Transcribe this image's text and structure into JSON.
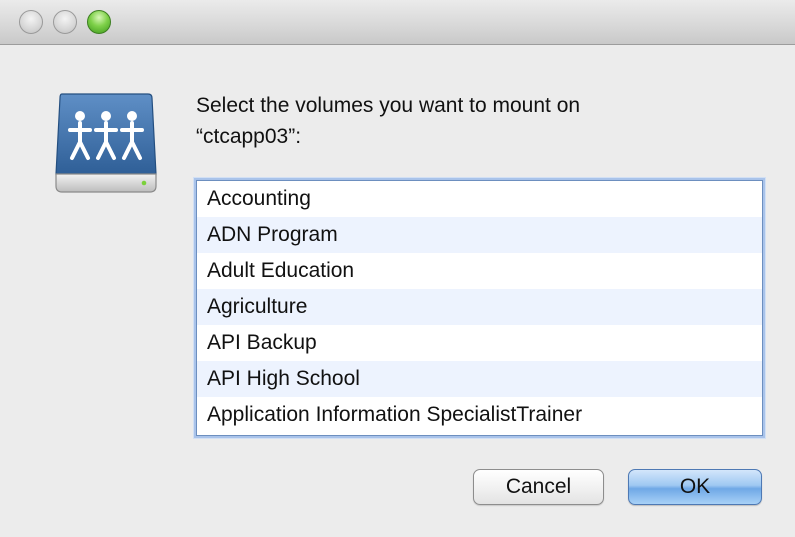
{
  "window": {
    "traffic_lights": [
      "close",
      "minimize",
      "zoom"
    ]
  },
  "dialog": {
    "icon": "shared-network-drive-icon",
    "prompt": "Select the volumes you want to mount on\n“ctcapp03”:",
    "volumes": [
      "Accounting",
      "ADN Program",
      "Adult Education",
      "Agriculture",
      "API Backup",
      "API High School",
      "Application Information SpecialistTrainer"
    ],
    "cancel_label": "Cancel",
    "ok_label": "OK"
  }
}
